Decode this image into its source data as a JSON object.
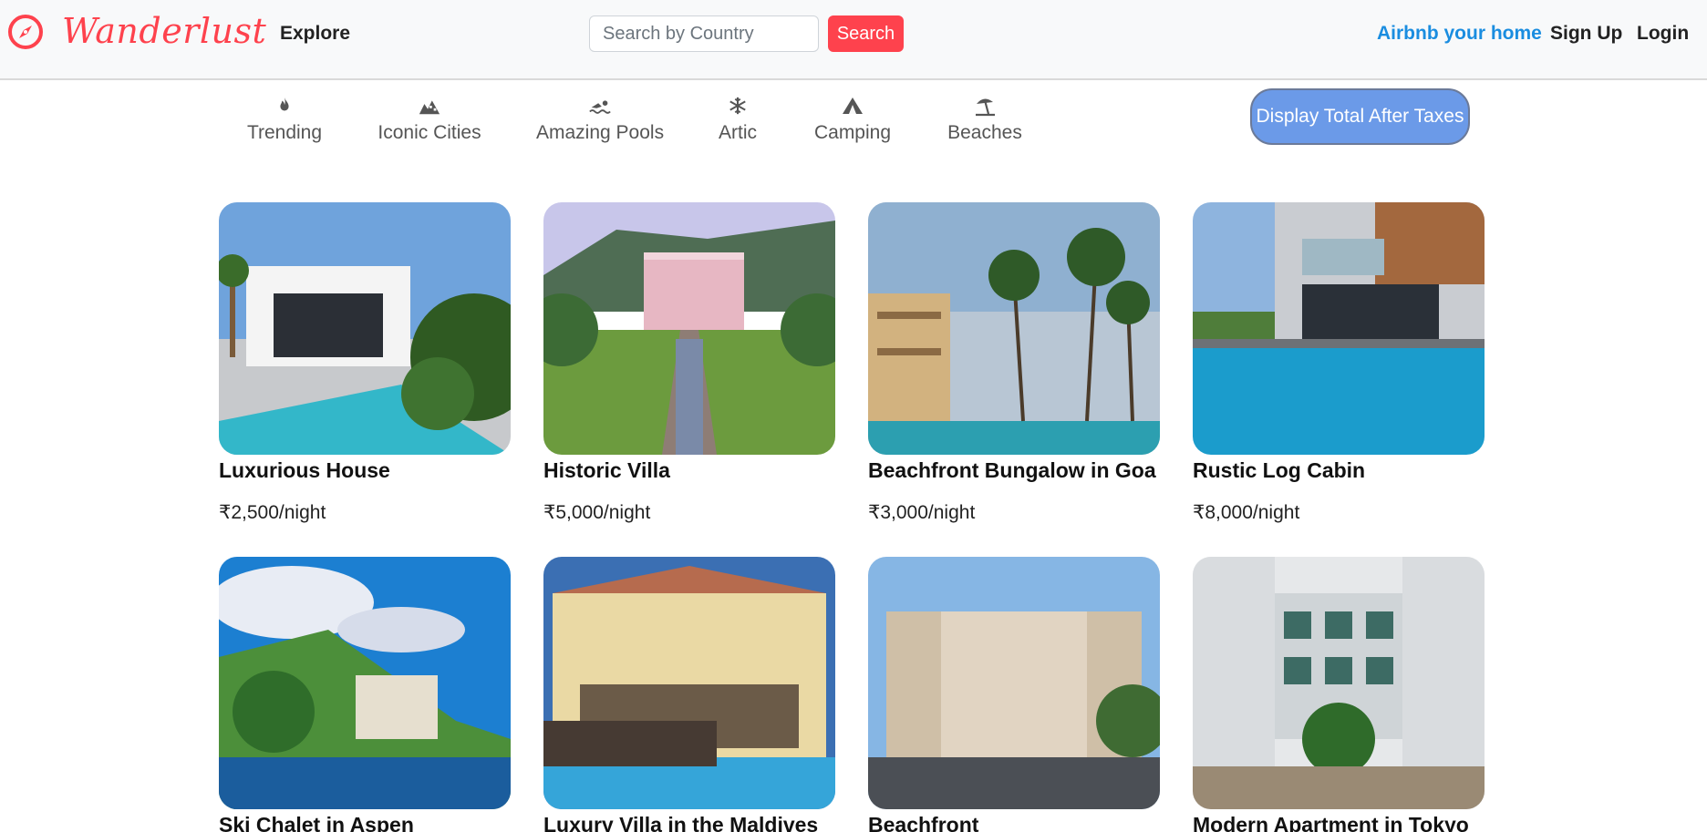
{
  "navbar": {
    "brand": "Wanderlust",
    "explore": "Explore",
    "search_placeholder": "Search by Country",
    "search_button": "Search",
    "host_link": "Airbnb your home",
    "signup": "Sign Up",
    "login": "Login"
  },
  "filters": [
    {
      "label": "Trending",
      "icon": "fire-icon"
    },
    {
      "label": "Iconic Cities",
      "icon": "city-icon"
    },
    {
      "label": "Amazing Pools",
      "icon": "swimmer-icon"
    },
    {
      "label": "Artic",
      "icon": "snowflake-icon"
    },
    {
      "label": "Camping",
      "icon": "tent-icon"
    },
    {
      "label": "Beaches",
      "icon": "umbrella-beach-icon"
    }
  ],
  "tax_toggle": "Display Total After Taxes",
  "listings": [
    {
      "title": "Luxurious House",
      "price": "₹2,500/night"
    },
    {
      "title": "Historic Villa",
      "price": "₹5,000/night"
    },
    {
      "title": "Beachfront Bungalow in Goa",
      "price": "₹3,000/night"
    },
    {
      "title": "Rustic Log Cabin",
      "price": "₹8,000/night"
    },
    {
      "title": "Ski Chalet in Aspen",
      "price": ""
    },
    {
      "title": "Luxury Villa in the Maldives",
      "price": ""
    },
    {
      "title": "Beachfront",
      "price": ""
    },
    {
      "title": "Modern Apartment in Tokyo",
      "price": ""
    }
  ],
  "colors": {
    "brand": "#fe424d",
    "host_link": "#1a8de0",
    "toggle_bg": "#6b9ae8"
  }
}
